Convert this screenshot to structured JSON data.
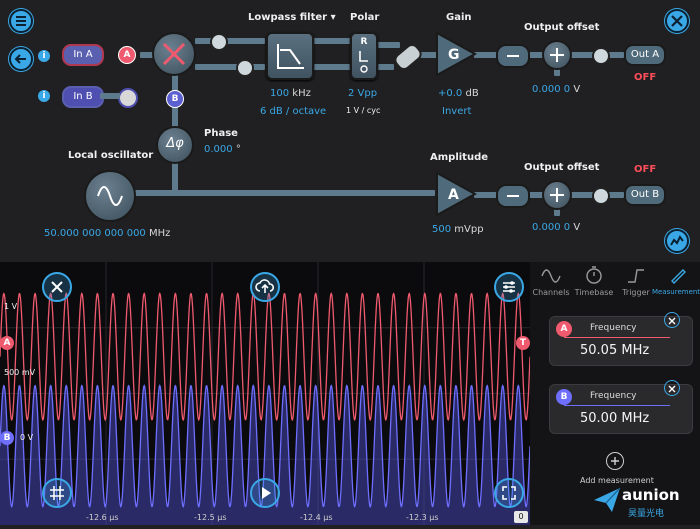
{
  "colors": {
    "accent": "#3aa8e6",
    "channel_a": "#f05a6e",
    "channel_b": "#6e6eff",
    "off": "#ff4e5a"
  },
  "signal_path": {
    "lowpass_filter": {
      "label": "Lowpass filter",
      "dropdown_icon": "caret-down-icon",
      "cutoff_value": "100",
      "cutoff_unit": "kHz",
      "slope": "6 dB / octave"
    },
    "polar": {
      "label": "Polar",
      "value": "2 Vpp",
      "scale": "1 V / cyc"
    },
    "gain": {
      "label": "Gain",
      "value": "+0.0",
      "unit": "dB",
      "invert_label": "Invert"
    },
    "output_offset_a": {
      "label": "Output offset",
      "value": "0.000 0",
      "unit": "V",
      "output_button": "Out A",
      "status": "OFF"
    },
    "input_a": {
      "button": "In A",
      "badge": "A"
    },
    "input_b": {
      "button": "In B",
      "badge": "B"
    },
    "mixer_badge": "B",
    "phase": {
      "label": "Phase",
      "value": "0.000",
      "unit": "°"
    },
    "local_oscillator": {
      "label": "Local oscillator",
      "value": "50.000 000 000 000",
      "unit": "MHz"
    },
    "amplitude": {
      "label": "Amplitude",
      "value": "500",
      "unit": "mVpp"
    },
    "output_offset_b": {
      "label": "Output offset",
      "value": "0.000 0",
      "unit": "V",
      "output_button": "Out B",
      "status": "OFF"
    }
  },
  "blocks": {
    "filter": "lowpass-filter-icon",
    "polar_glyph": "R",
    "gain_glyph": "G",
    "amplitude_glyph": "A",
    "phase_glyph": "Δφ"
  },
  "scope": {
    "levels": {
      "one_volt": "1 V",
      "five_hundred_mv": "500 mV",
      "zero_volt": "0 V"
    },
    "channel_markers": {
      "a": "A",
      "b": "B",
      "trigger": "T"
    },
    "time_ticks": [
      "-12.6 µs",
      "-12.5 µs",
      "-12.4 µs",
      "-12.3 µs"
    ],
    "time_end_marker": "0",
    "channel_a_cycles": 34,
    "channel_b_cycles": 34,
    "channel_a_level_ratio": 0.5
  },
  "panel": {
    "tabs": [
      {
        "label": "Channels",
        "icon": "sine-icon"
      },
      {
        "label": "Timebase",
        "icon": "timer-icon"
      },
      {
        "label": "Trigger",
        "icon": "trigger-edge-icon"
      },
      {
        "label": "Measurements",
        "icon": "ruler-icon"
      }
    ],
    "measurements": [
      {
        "channel": "A",
        "title": "Frequency",
        "value": "50.05 MHz"
      },
      {
        "channel": "B",
        "title": "Frequency",
        "value": "50.00 MHz"
      }
    ],
    "add_label": "Add measurement"
  },
  "watermark": {
    "brand": "aunion",
    "subtitle": "昊量光电"
  }
}
